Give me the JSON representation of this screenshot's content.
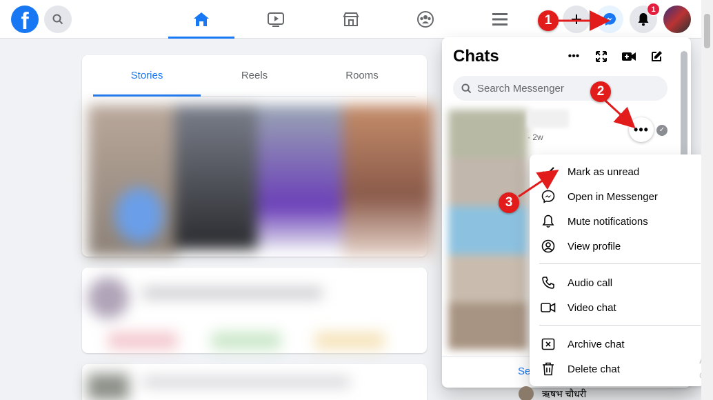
{
  "topbar": {
    "logo_letter": "f",
    "notification_badge": "1",
    "nav_tabs": [
      "home",
      "watch",
      "marketplace",
      "groups",
      "menu"
    ]
  },
  "stories": {
    "tabs": [
      {
        "label": "Stories",
        "active": true
      },
      {
        "label": "Reels",
        "active": false
      },
      {
        "label": "Rooms",
        "active": false
      }
    ]
  },
  "chats": {
    "title": "Chats",
    "search_placeholder": "Search Messenger",
    "time_label": "· 2w",
    "see_all": "Se"
  },
  "context_menu": {
    "items": [
      {
        "label": "Mark as unread",
        "icon": "check-icon"
      },
      {
        "label": "Open in Messenger",
        "icon": "messenger-icon"
      },
      {
        "label": "Mute notifications",
        "icon": "bell-icon"
      },
      {
        "label": "View profile",
        "icon": "profile-icon"
      },
      {
        "label": "Audio call",
        "icon": "phone-icon"
      },
      {
        "label": "Video chat",
        "icon": "video-icon"
      },
      {
        "label": "Archive chat",
        "icon": "archive-icon"
      },
      {
        "label": "Delete chat",
        "icon": "trash-icon"
      }
    ]
  },
  "annotations": {
    "step1": "1",
    "step2": "2",
    "step3": "3"
  },
  "contacts": {
    "bottom_name": "ऋषभ चौधरी"
  },
  "watermark": {
    "line1": "Ac",
    "line2": "Go"
  },
  "colors": {
    "brand": "#1877f2",
    "annotation": "#e21b1b",
    "badge": "#e41e3f"
  }
}
